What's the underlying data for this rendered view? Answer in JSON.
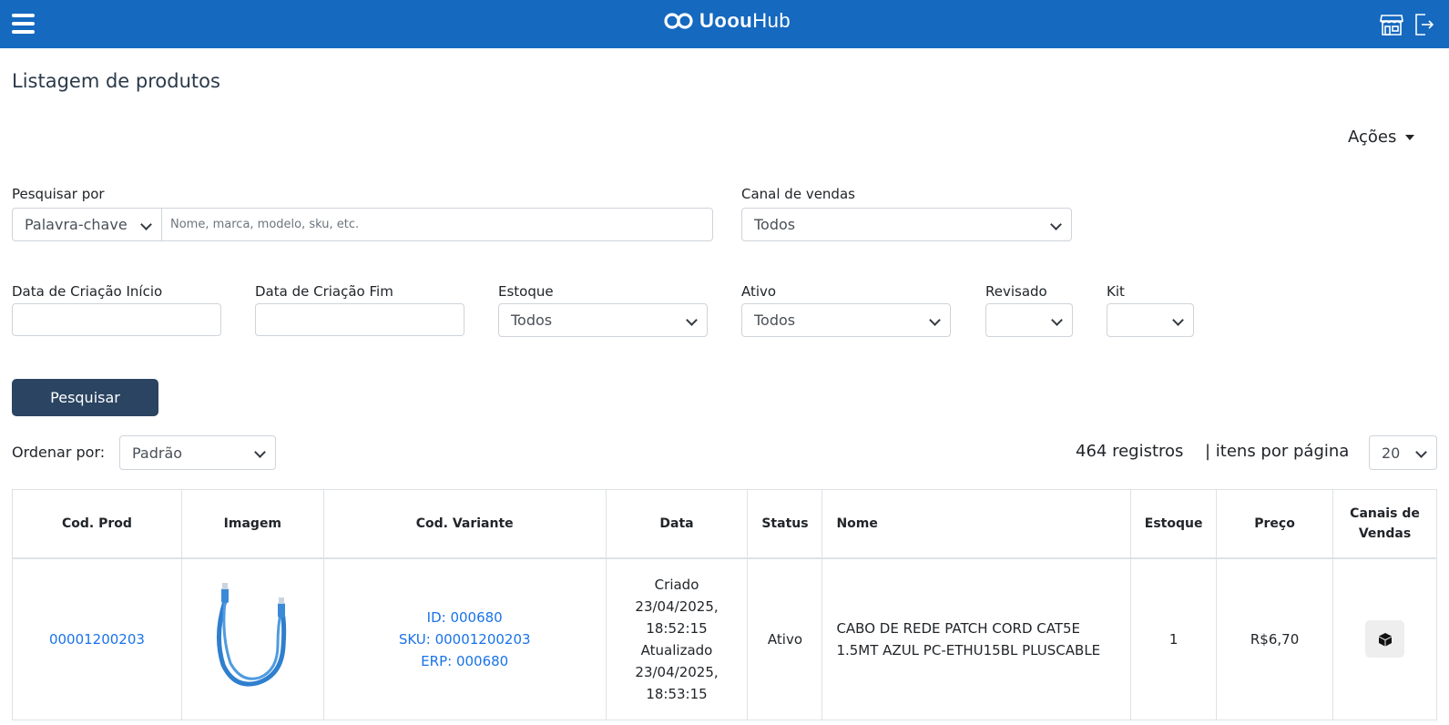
{
  "header": {
    "logo_bold": "Uoou",
    "logo_light": "Hub"
  },
  "page": {
    "title": "Listagem de produtos",
    "actions_label": "Ações"
  },
  "filters": {
    "search_by_label": "Pesquisar por",
    "search_by_value": "Palavra-chave",
    "search_placeholder": "Nome, marca, modelo, sku, etc.",
    "channel_label": "Canal de vendas",
    "channel_value": "Todos",
    "date_start_label": "Data de Criação Início",
    "date_end_label": "Data de Criação Fim",
    "stock_label": "Estoque",
    "stock_value": "Todos",
    "active_label": "Ativo",
    "active_value": "Todos",
    "reviewed_label": "Revisado",
    "reviewed_value": "",
    "kit_label": "Kit",
    "kit_value": "",
    "search_button": "Pesquisar"
  },
  "listing": {
    "sort_label": "Ordenar por:",
    "sort_value": "Padrão",
    "records": "464 registros",
    "per_page_label": "| itens por página",
    "per_page_value": "20"
  },
  "table": {
    "headers": {
      "cod_prod": "Cod. Prod",
      "imagem": "Imagem",
      "cod_variante": "Cod. Variante",
      "data": "Data",
      "status": "Status",
      "nome": "Nome",
      "estoque": "Estoque",
      "preco": "Preço",
      "canais_line1": "Canais de",
      "canais_line2": "Vendas"
    },
    "rows": [
      {
        "cod_prod": "00001200203",
        "variant_id": "ID: 000680",
        "variant_sku": "SKU: 00001200203",
        "variant_erp": "ERP: 000680",
        "date_created_label": "Criado",
        "date_created_day": "23/04/2025,",
        "date_created_time": "18:52:15",
        "date_updated_label": "Atualizado",
        "date_updated_day": "23/04/2025,",
        "date_updated_time": "18:53:15",
        "status": "Ativo",
        "nome": "CABO DE REDE PATCH CORD CAT5E 1.5MT AZUL PC-ETHU15BL PLUSCABLE",
        "estoque": "1",
        "preco": "R$6,70"
      }
    ]
  },
  "colors": {
    "topbar": "#1569bf",
    "search_button": "#2a4462",
    "link": "#1a73e8"
  }
}
